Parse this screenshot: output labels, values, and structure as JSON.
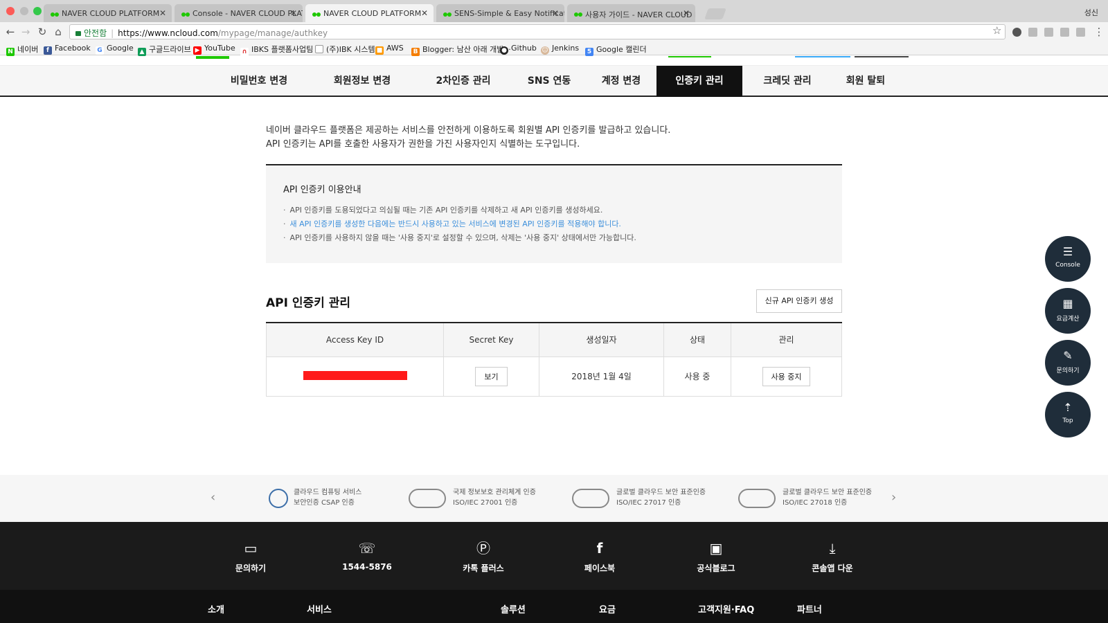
{
  "browser": {
    "tabs": [
      {
        "title": "NAVER CLOUD PLATFORM",
        "active": false
      },
      {
        "title": "Console - NAVER CLOUD PLAT",
        "active": false
      },
      {
        "title": "NAVER CLOUD PLATFORM",
        "active": true
      },
      {
        "title": "SENS-Simple & Easy Notificat",
        "active": false
      },
      {
        "title": "사용자 가이드 - NAVER CLOUD P",
        "active": false
      }
    ],
    "user": "성신",
    "secure_label": "안전함",
    "url_host": "https://www.ncloud.com",
    "url_path": "/mypage/manage/authkey",
    "bookmarks": [
      "네이버",
      "Facebook",
      "Google",
      "구글드라이브",
      "YouTube",
      "IBKS 플랫폼사업팀",
      "(주)IBK 시스템",
      "AWS",
      "Blogger: 남산 아래 개발···",
      "Github",
      "Jenkins",
      "Google 캘린더"
    ]
  },
  "subnav": {
    "items": [
      {
        "label": "비밀번호 변경",
        "active": false
      },
      {
        "label": "회원정보 변경",
        "active": false
      },
      {
        "label": "2차인증 관리",
        "active": false
      },
      {
        "label": "SNS 연동",
        "active": false
      },
      {
        "label": "계정 변경",
        "active": false
      },
      {
        "label": "인증키 관리",
        "active": true
      },
      {
        "label": "크레딧 관리",
        "active": false
      },
      {
        "label": "회원 탈퇴",
        "active": false
      }
    ]
  },
  "intro": {
    "line1": "네이버 클라우드 플랫폼은 제공하는 서비스를 안전하게 이용하도록 회원별 API 인증키를 발급하고 있습니다.",
    "line2": "API 인증키는 API를 호출한 사용자가 권한을 가진 사용자인지 식별하는 도구입니다."
  },
  "guide": {
    "title": "API 인증키 이용안내",
    "items": [
      {
        "text": "API 인증키를 도용되었다고 의심될 때는 기존 API 인증키를 삭제하고 새 API 인증키를 생성하세요.",
        "highlight": false
      },
      {
        "text": "새 API 인증키를 생성한 다음에는 반드시 사용하고 있는 서비스에 변경된 API 인증키를 적용해야 합니다.",
        "highlight": true
      },
      {
        "text": "API 인증키를 사용하지 않을 때는 '사용 중지'로 설정할 수 있으며, 삭제는 '사용 중지' 상태에서만 가능합니다.",
        "highlight": false
      }
    ]
  },
  "management": {
    "title": "API 인증키 관리",
    "new_key_button": "신규 API 인증키 생성",
    "columns": [
      "Access Key ID",
      "Secret Key",
      "생성일자",
      "상태",
      "관리"
    ],
    "rows": [
      {
        "secret_button": "보기",
        "created": "2018년 1월 4일",
        "status": "사용 중",
        "action_button": "사용 중지"
      }
    ]
  },
  "certifications": [
    {
      "line1": "클라우드 컴퓨팅 서비스",
      "line2": "보안인증 CSAP 인증"
    },
    {
      "line1": "국제 정보보호 관리체계 인증",
      "line2": "ISO/IEC 27001 인증"
    },
    {
      "line1": "글로벌 클라우드 보안 표준인증",
      "line2": "ISO/IEC 27017 인증"
    },
    {
      "line1": "글로벌 클라우드 보안 표준인증",
      "line2": "ISO/IEC 27018 인증"
    }
  ],
  "footer": {
    "items": [
      {
        "label": "문의하기",
        "icon": "laptop-icon"
      },
      {
        "label": "1544-5876",
        "icon": "phone-icon"
      },
      {
        "label": "카톡 플러스",
        "icon": "kakao-plus-icon"
      },
      {
        "label": "페이스북",
        "icon": "facebook-icon"
      },
      {
        "label": "공식블로그",
        "icon": "blog-icon"
      },
      {
        "label": "콘솔앱 다운",
        "icon": "download-icon"
      }
    ],
    "links": [
      "소개",
      "서비스",
      "솔루션",
      "요금",
      "고객지원·FAQ",
      "파트너"
    ]
  },
  "floating": [
    {
      "label": "Console",
      "icon": "console-icon"
    },
    {
      "label": "요금계산",
      "icon": "calculator-icon"
    },
    {
      "label": "문의하기",
      "icon": "edit-icon"
    },
    {
      "label": "Top",
      "icon": "top-arrow-icon"
    }
  ],
  "colors": {
    "brand_green": "#1ec800",
    "highlight_blue": "#3c8fdb",
    "fab_bg": "#1f2d3a",
    "redaction": "#ff1a1a"
  }
}
